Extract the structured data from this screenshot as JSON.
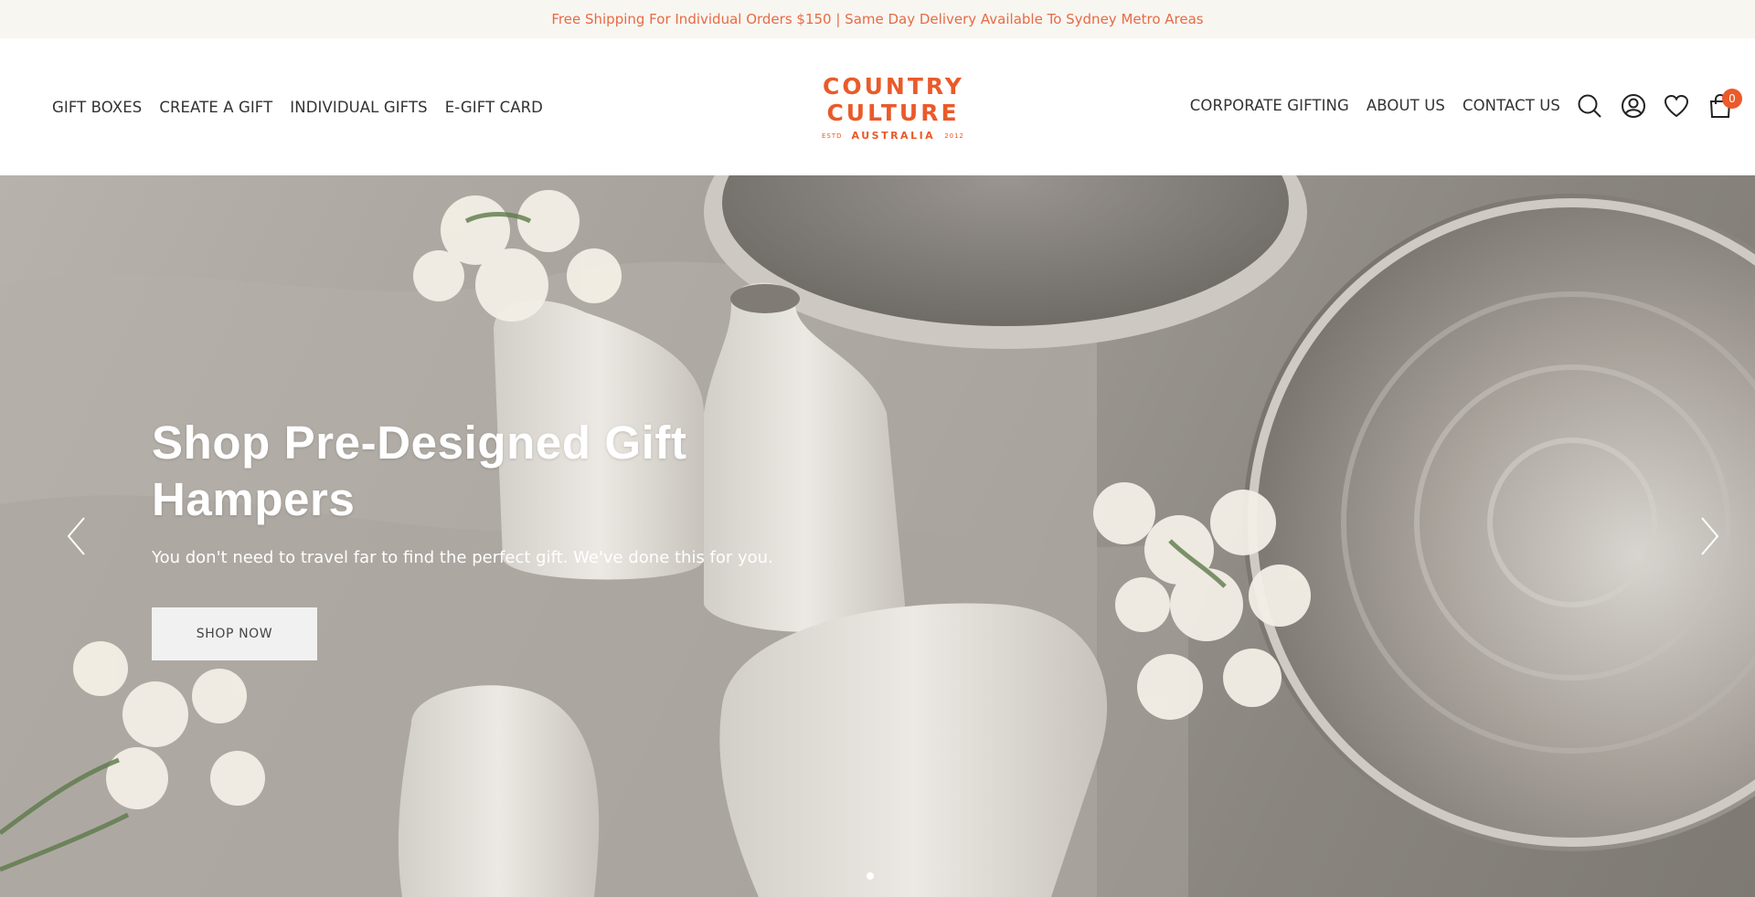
{
  "announcement": {
    "text": "Free Shipping For Individual Orders $150  | Same Day Delivery Available To Sydney Metro Areas"
  },
  "header": {
    "left_nav": [
      {
        "label": "GIFT BOXES"
      },
      {
        "label": "CREATE A GIFT"
      },
      {
        "label": "INDIVIDUAL GIFTS"
      },
      {
        "label": "E-GIFT CARD"
      }
    ],
    "right_nav": [
      {
        "label": "CORPORATE GIFTING"
      },
      {
        "label": "ABOUT US"
      },
      {
        "label": "CONTACT US"
      }
    ],
    "logo": {
      "line1": "COUNTRY",
      "line2": "CULTURE",
      "estd": "ESTD",
      "country": "AUSTRALIA",
      "year": "2012"
    },
    "icons": [
      "search-icon",
      "account-icon",
      "heart-icon",
      "cart-icon"
    ],
    "cart_count": "0"
  },
  "hero": {
    "title": "Shop Pre-Designed Gift Hampers",
    "subtitle": "You don't need to travel far to find the perfect gift. We've done this for you.",
    "button_label": "SHOP NOW",
    "slide_count": 1
  },
  "colors": {
    "accent": "#ea5a2a",
    "announcement_bg": "#f8f6f1",
    "announcement_text": "#e76b45",
    "nav_text": "#333333"
  }
}
